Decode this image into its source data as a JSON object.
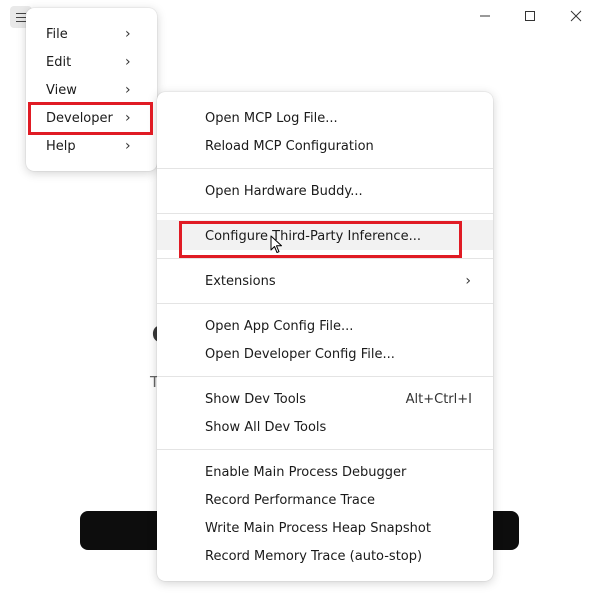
{
  "window": {
    "minimize_icon": "minimize-icon",
    "maximize_icon": "maximize-icon",
    "close_icon": "close-icon"
  },
  "background": {
    "heading_fragment": "C",
    "subtitle_fragment": "T"
  },
  "main_menu": {
    "items": [
      {
        "label": "File"
      },
      {
        "label": "Edit"
      },
      {
        "label": "View"
      },
      {
        "label": "Developer"
      },
      {
        "label": "Help"
      }
    ]
  },
  "developer_menu": {
    "items": [
      {
        "label": "Open MCP Log File..."
      },
      {
        "label": "Reload MCP Configuration"
      },
      {
        "label": "Open Hardware Buddy..."
      },
      {
        "label": "Configure Third-Party Inference..."
      },
      {
        "label": "Extensions"
      },
      {
        "label": "Open App Config File..."
      },
      {
        "label": "Open Developer Config File..."
      },
      {
        "label": "Show Dev Tools",
        "shortcut": "Alt+Ctrl+I"
      },
      {
        "label": "Show All Dev Tools"
      },
      {
        "label": "Enable Main Process Debugger"
      },
      {
        "label": "Record Performance Trace"
      },
      {
        "label": "Write Main Process Heap Snapshot"
      },
      {
        "label": "Record Memory Trace (auto-stop)"
      }
    ]
  },
  "colors": {
    "highlight": "#e01b24",
    "hover": "#f2f2f2"
  }
}
